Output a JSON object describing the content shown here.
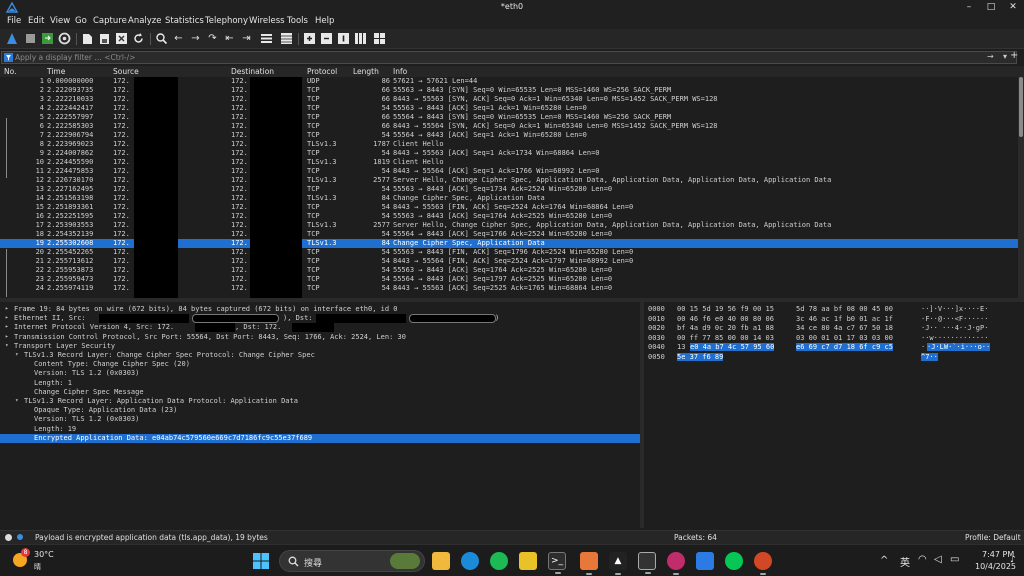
{
  "window": {
    "title": "*eth0",
    "minimize": "–",
    "maximize": "□",
    "close": "✕"
  },
  "menu": [
    "File",
    "Edit",
    "View",
    "Go",
    "Capture",
    "Analyze",
    "Statistics",
    "Telephony",
    "Wireless",
    "Tools",
    "Help"
  ],
  "filter": {
    "placeholder": "Apply a display filter … <Ctrl-/>",
    "apply_arrow": "→",
    "dropdown_arrow": "▾",
    "add": "+"
  },
  "columns": {
    "no": "No.",
    "time": "Time",
    "source": "Source",
    "destination": "Destination",
    "protocol": "Protocol",
    "length": "Length",
    "info": "Info"
  },
  "packets": [
    {
      "no": "1",
      "time": "0.000000000",
      "src": "172.",
      "dst": "172.",
      "proto": "UDP",
      "len": "86",
      "info": "57621 → 57621 Len=44"
    },
    {
      "no": "2",
      "time": "2.222093735",
      "src": "172.",
      "dst": "172.",
      "proto": "TCP",
      "len": "66",
      "info": "55563 → 8443 [SYN] Seq=0 Win=65535 Len=0 MSS=1460 WS=256 SACK_PERM"
    },
    {
      "no": "3",
      "time": "2.222210033",
      "src": "172.",
      "dst": "172.",
      "proto": "TCP",
      "len": "66",
      "info": "8443 → 55563 [SYN, ACK] Seq=0 Ack=1 Win=65340 Len=0 MSS=1452 SACK_PERM WS=128"
    },
    {
      "no": "4",
      "time": "2.222442417",
      "src": "172.",
      "dst": "172.",
      "proto": "TCP",
      "len": "54",
      "info": "55563 → 8443 [ACK] Seq=1 Ack=1 Win=65280 Len=0"
    },
    {
      "no": "5",
      "time": "2.222557997",
      "src": "172.",
      "dst": "172.",
      "proto": "TCP",
      "len": "66",
      "info": "55564 → 8443 [SYN] Seq=0 Win=65535 Len=0 MSS=1460 WS=256 SACK_PERM"
    },
    {
      "no": "6",
      "time": "2.222585303",
      "src": "172.",
      "dst": "172.",
      "proto": "TCP",
      "len": "66",
      "info": "8443 → 55564 [SYN, ACK] Seq=0 Ack=1 Win=65340 Len=0 MSS=1452 SACK_PERM WS=128"
    },
    {
      "no": "7",
      "time": "2.222906794",
      "src": "172.",
      "dst": "172.",
      "proto": "TCP",
      "len": "54",
      "info": "55564 → 8443 [ACK] Seq=1 Ack=1 Win=65280 Len=0"
    },
    {
      "no": "8",
      "time": "2.223969023",
      "src": "172.",
      "dst": "172.",
      "proto": "TLSv1.3",
      "len": "1787",
      "info": "Client Hello"
    },
    {
      "no": "9",
      "time": "2.224007862",
      "src": "172.",
      "dst": "172.",
      "proto": "TCP",
      "len": "54",
      "info": "8443 → 55563 [ACK] Seq=1 Ack=1734 Win=68864 Len=0"
    },
    {
      "no": "10",
      "time": "2.224455590",
      "src": "172.",
      "dst": "172.",
      "proto": "TLSv1.3",
      "len": "1819",
      "info": "Client Hello"
    },
    {
      "no": "11",
      "time": "2.224475853",
      "src": "172.",
      "dst": "172.",
      "proto": "TCP",
      "len": "54",
      "info": "8443 → 55564 [ACK] Seq=1 Ack=1766 Win=68992 Len=0"
    },
    {
      "no": "12",
      "time": "2.226730170",
      "src": "172.",
      "dst": "172.",
      "proto": "TLSv1.3",
      "len": "2577",
      "info": "Server Hello, Change Cipher Spec, Application Data, Application Data, Application Data, Application Data"
    },
    {
      "no": "13",
      "time": "2.227162495",
      "src": "172.",
      "dst": "172.",
      "proto": "TCP",
      "len": "54",
      "info": "55563 → 8443 [ACK] Seq=1734 Ack=2524 Win=65280 Len=0"
    },
    {
      "no": "14",
      "time": "2.251563198",
      "src": "172.",
      "dst": "172.",
      "proto": "TLSv1.3",
      "len": "84",
      "info": "Change Cipher Spec, Application Data"
    },
    {
      "no": "15",
      "time": "2.251893361",
      "src": "172.",
      "dst": "172.",
      "proto": "TCP",
      "len": "54",
      "info": "8443 → 55563 [FIN, ACK] Seq=2524 Ack=1764 Win=68864 Len=0"
    },
    {
      "no": "16",
      "time": "2.252251595",
      "src": "172.",
      "dst": "172.",
      "proto": "TCP",
      "len": "54",
      "info": "55563 → 8443 [ACK] Seq=1764 Ack=2525 Win=65280 Len=0"
    },
    {
      "no": "17",
      "time": "2.253903553",
      "src": "172.",
      "dst": "172.",
      "proto": "TLSv1.3",
      "len": "2577",
      "info": "Server Hello, Change Cipher Spec, Application Data, Application Data, Application Data, Application Data"
    },
    {
      "no": "18",
      "time": "2.254352139",
      "src": "172.",
      "dst": "172.",
      "proto": "TCP",
      "len": "54",
      "info": "55564 → 8443 [ACK] Seq=1766 Ack=2524 Win=65280 Len=0"
    },
    {
      "no": "19",
      "time": "2.255302608",
      "src": "172.",
      "dst": "172.",
      "proto": "TLSv1.3",
      "len": "84",
      "info": "Change Cipher Spec, Application Data",
      "selected": true
    },
    {
      "no": "20",
      "time": "2.255452265",
      "src": "172.",
      "dst": "172.",
      "proto": "TCP",
      "len": "54",
      "info": "55563 → 8443 [FIN, ACK] Seq=1796 Ack=2524 Win=65280 Len=0"
    },
    {
      "no": "21",
      "time": "2.255713612",
      "src": "172.",
      "dst": "172.",
      "proto": "TCP",
      "len": "54",
      "info": "8443 → 55564 [FIN, ACK] Seq=2524 Ack=1797 Win=68992 Len=0"
    },
    {
      "no": "22",
      "time": "2.255953873",
      "src": "172.",
      "dst": "172.",
      "proto": "TCP",
      "len": "54",
      "info": "55563 → 8443 [ACK] Seq=1764 Ack=2525 Win=65280 Len=0"
    },
    {
      "no": "23",
      "time": "2.255959473",
      "src": "172.",
      "dst": "172.",
      "proto": "TCP",
      "len": "54",
      "info": "55564 → 8443 [ACK] Seq=1797 Ack=2525 Win=65280 Len=0"
    },
    {
      "no": "24",
      "time": "2.255974119",
      "src": "172.",
      "dst": "172.",
      "proto": "TCP",
      "len": "54",
      "info": "8443 → 55563 [ACK] Seq=2525 Ack=1765 Win=68864 Len=0"
    }
  ],
  "details": [
    {
      "twisty": "▸",
      "text": "Frame 19: 84 bytes on wire (672 bits), 84 bytes captured (672 bits) on interface eth0, id 0"
    },
    {
      "twisty": "▸",
      "text": "Ethernet II, Src:"
    },
    {
      "twisty": "▸",
      "text": "Internet Protocol Version 4, Src: 172."
    },
    {
      "twisty": "▸",
      "text": "Transmission Control Protocol, Src Port: 55564, Dst Port: 8443, Seq: 1766, Ack: 2524, Len: 30"
    },
    {
      "twisty": "▾",
      "text": "Transport Layer Security"
    },
    {
      "twisty": "▾",
      "text": "TLSv1.3 Record Layer: Change Cipher Spec Protocol: Change Cipher Spec"
    },
    {
      "twisty": "",
      "text": "Content Type: Change Cipher Spec (20)"
    },
    {
      "twisty": "",
      "text": "Version: TLS 1.2 (0x0303)"
    },
    {
      "twisty": "",
      "text": "Length: 1"
    },
    {
      "twisty": "",
      "text": "Change Cipher Spec Message"
    },
    {
      "twisty": "▾",
      "text": "TLSv1.3 Record Layer: Application Data Protocol: Application Data"
    },
    {
      "twisty": "",
      "text": "Opaque Type: Application Data (23)"
    },
    {
      "twisty": "",
      "text": "Version: TLS 1.2 (0x0303)"
    },
    {
      "twisty": "",
      "text": "Length: 19"
    },
    {
      "twisty": "",
      "text": "Encrypted Application Data: e04ab74c579560e669c7d7186fc9c55e37f689",
      "selected": true
    }
  ],
  "detail_extras": {
    "eth_dst": "), Dst:",
    "eth_close": ")",
    "ip_dst": ", Dst: 172."
  },
  "bytes": [
    {
      "off": "0000",
      "hex1": "00 15 5d 19 56 f9 00 15",
      "hex2": "5d 78 aa bf 08 00 45 00",
      "ascii": "··]·V···]x····E·"
    },
    {
      "off": "0010",
      "hex1": "00 46 f6 e0 40 00 80 06",
      "hex2": "3c 46 ac 1f b0 01 ac 1f",
      "ascii": "·F··@···<F······"
    },
    {
      "off": "0020",
      "hex1": "bf 4a d9 0c 20 fb a1 88",
      "hex2": "34 ce 80 4a c7 67 50 18",
      "ascii": "·J·· ···4··J·gP·"
    },
    {
      "off": "0030",
      "hex1": "00 ff 77 85 00 00 14 03",
      "hex2": "03 00 01 01 17 03 03 00",
      "ascii": "··w·············"
    },
    {
      "off": "0040",
      "hex1": "13",
      "hex1b": "e0 4a b7 4c 57 95 60",
      "hex2": "e6 69 c7 d7 18 6f c9 c5",
      "ascii1": "·",
      "ascii2": "·J·LW·`·i···o··"
    },
    {
      "off": "0050",
      "hex1": "",
      "hex1b": "5e 37 f6 89",
      "hex2": "",
      "ascii1": "",
      "ascii2": "^7··"
    }
  ],
  "status": {
    "message": "Payload is encrypted application data (tls.app_data), 19 bytes",
    "packets": "Packets: 64",
    "profile": "Profile: Default"
  },
  "taskbar": {
    "weather_temp": "30°C",
    "weather_cond": "晴",
    "weather_badge": "8",
    "search_placeholder": "搜尋",
    "ime": "英",
    "time": "7:47 PM",
    "date": "10/4/2025",
    "tray_arrow": "^"
  },
  "colors": {
    "accent": "#1f6fd1",
    "wireshark_fin": "#1a73e8",
    "bg": "#1e1e1e"
  }
}
